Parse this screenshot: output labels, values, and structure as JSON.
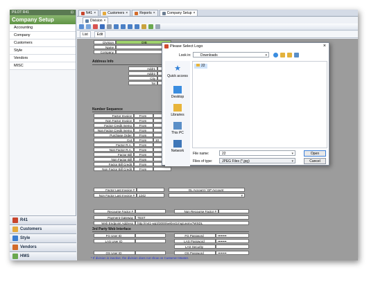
{
  "sidebar": {
    "topbar": "PILOT R41",
    "title": "Company Setup",
    "items": [
      {
        "label": "Accounting"
      },
      {
        "label": "Company"
      },
      {
        "label": "Customers"
      },
      {
        "label": "Style"
      },
      {
        "label": "Vendors"
      },
      {
        "label": "MISC"
      }
    ],
    "nav": [
      {
        "label": "R41",
        "color": "#c8452c"
      },
      {
        "label": "Customers",
        "color": "#e4a93b"
      },
      {
        "label": "Style",
        "color": "#3a7dd1"
      },
      {
        "label": "Vendors",
        "color": "#d36b2a"
      },
      {
        "label": "HMS",
        "color": "#6aa84f"
      }
    ]
  },
  "tabs": [
    {
      "label": "N41"
    },
    {
      "label": "Customers"
    },
    {
      "label": "Reports"
    },
    {
      "label": "Company Setup"
    }
  ],
  "subtab": {
    "label": "Division"
  },
  "modes": {
    "list": "List",
    "edit": "Edit"
  },
  "form": {
    "division_label": "Division",
    "division_value": "DIB",
    "name_label": "Name",
    "company_label": "Company",
    "address_section": "Address Info",
    "addr1": "Addr1",
    "addr2": "Addr2",
    "city": "City",
    "tel": "Tel",
    "number_section": "Number Sequence",
    "seq_rows": [
      {
        "label": "Factor Invoice",
        "from": "From",
        "value": ""
      },
      {
        "label": "Non Factor Invoice",
        "from": "From",
        "value": ""
      },
      {
        "label": "Factor Credit memo",
        "from": "From",
        "value": ""
      },
      {
        "label": "Non Factor Credit memo",
        "from": "From",
        "value": ""
      },
      {
        "label": "Purchase Order",
        "from": "From",
        "value": ""
      },
      {
        "label": "Cut",
        "from": "From",
        "value": "10"
      },
      {
        "label": "Factor R.A.",
        "from": "From",
        "value": ""
      },
      {
        "label": "Non Factor R.A.",
        "from": "From",
        "value": ""
      },
      {
        "label": "Factor Bill",
        "from": "From",
        "value": ""
      },
      {
        "label": "Non Factor Bill",
        "from": "From",
        "value": ""
      },
      {
        "label": "Factor Bill Credit",
        "from": "From",
        "value": ""
      },
      {
        "label": "Non Factor Bill Credit",
        "from": "From",
        "value": ""
      }
    ],
    "factor_last_invoice": "Factor Last Invoice #",
    "non_factor_last_invoice": "Non Factor Last Invoice #",
    "non_factor_last_invoice_value": "1242",
    "gl_account": "GL Account / GP Account",
    "recourse_factor": "Recourse Factor #",
    "non_recourse_factor": "Non Recourse Factor #",
    "payment_gateway": "Payment Gateway",
    "payment_gateway_value": "TEST",
    "web_endpoint": "Web Endpoint Address",
    "web_endpoint_value": "http://m41-wp3/3000/webn41/mgt.asmx?WSDL",
    "third_party_section": "3rd Party Web Interface",
    "fg_user_id": "FG User ID",
    "fg_password": "FG Password",
    "las_user_id": "LAS User ID",
    "las_password": "LAS Password",
    "las_security": "LAS Security",
    "os_user_id": "OS User ID",
    "os_password": "OS Password",
    "password_mask": "••••••••",
    "note": "* If division is inactive, the division does not show on Customer Master."
  },
  "dialog": {
    "title": "Please Select Logo",
    "look_in_label": "Look in:",
    "look_in_value": "Downloads",
    "folder_item": "22",
    "places": [
      {
        "label": "Quick access",
        "color": "#2f7fd6"
      },
      {
        "label": "Desktop",
        "color": "#3a8de0"
      },
      {
        "label": "Libraries",
        "color": "#e8b43a"
      },
      {
        "label": "This PC",
        "color": "#5a8fc8"
      },
      {
        "label": "Network",
        "color": "#3f77b8"
      }
    ],
    "file_name_label": "File name:",
    "file_name_value": "22",
    "files_of_type_label": "Files of type:",
    "files_of_type_value": "JPEG Files (*.jpg)",
    "open_button": "Open",
    "cancel_button": "Cancel"
  }
}
